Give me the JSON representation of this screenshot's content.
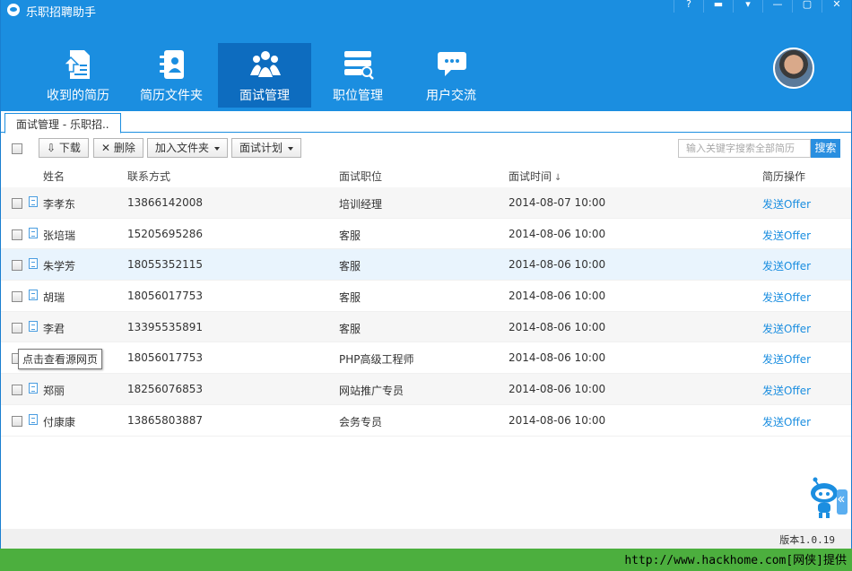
{
  "app": {
    "title": "乐职招聘助手"
  },
  "window_controls": [
    "?",
    "▬",
    "▾",
    "—",
    "▢",
    "✕"
  ],
  "nav": [
    {
      "label": "收到的简历",
      "icon": "resume-upload-icon",
      "active": false
    },
    {
      "label": "简历文件夹",
      "icon": "contacts-folder-icon",
      "active": false
    },
    {
      "label": "面试管理",
      "icon": "people-group-icon",
      "active": true
    },
    {
      "label": "职位管理",
      "icon": "server-search-icon",
      "active": false
    },
    {
      "label": "用户交流",
      "icon": "chat-bubble-icon",
      "active": false
    }
  ],
  "tab": {
    "label": "面试管理 - 乐职招.."
  },
  "toolbar": {
    "download": "下载",
    "delete": "删除",
    "add_folder": "加入文件夹",
    "schedule": "面试计划",
    "search_placeholder": "输入关键字搜索全部简历",
    "search_button": "搜索"
  },
  "table": {
    "headers": {
      "name": "姓名",
      "contact": "联系方式",
      "position": "面试职位",
      "time": "面试时间",
      "sort_indicator": "↓",
      "action": "简历操作"
    },
    "rows": [
      {
        "name": "李孝东",
        "phone": "13866142008",
        "position": "培训经理",
        "time": "2014-08-07 10:00",
        "action": "发送Offer"
      },
      {
        "name": "张培瑞",
        "phone": "15205695286",
        "position": "客服",
        "time": "2014-08-06 10:00",
        "action": "发送Offer"
      },
      {
        "name": "朱学芳",
        "phone": "18055352115",
        "position": "客服",
        "time": "2014-08-06 10:00",
        "action": "发送Offer"
      },
      {
        "name": "胡瑞",
        "phone": "18056017753",
        "position": "客服",
        "time": "2014-08-06 10:00",
        "action": "发送Offer"
      },
      {
        "name": "李君",
        "phone": "13395535891",
        "position": "客服",
        "time": "2014-08-06 10:00",
        "action": "发送Offer"
      },
      {
        "name": "",
        "phone": "18056017753",
        "position": "PHP高级工程师",
        "time": "2014-08-06 10:00",
        "action": "发送Offer"
      },
      {
        "name": "郑丽",
        "phone": "18256076853",
        "position": "网站推广专员",
        "time": "2014-08-06 10:00",
        "action": "发送Offer"
      },
      {
        "name": "付康康",
        "phone": "13865803887",
        "position": "会务专员",
        "time": "2014-08-06 10:00",
        "action": "发送Offer"
      }
    ]
  },
  "tooltip": {
    "text": "点击查看源网页"
  },
  "footer": {
    "version": "版本1.0.19"
  },
  "watermark": {
    "text": "http://www.hackhome.com[网侠]提供"
  },
  "colors": {
    "header_blue": "#1b8ee0",
    "active_nav": "#0d6cbf",
    "link_blue": "#1b8ee0",
    "watermark_green": "#4caf3e"
  }
}
